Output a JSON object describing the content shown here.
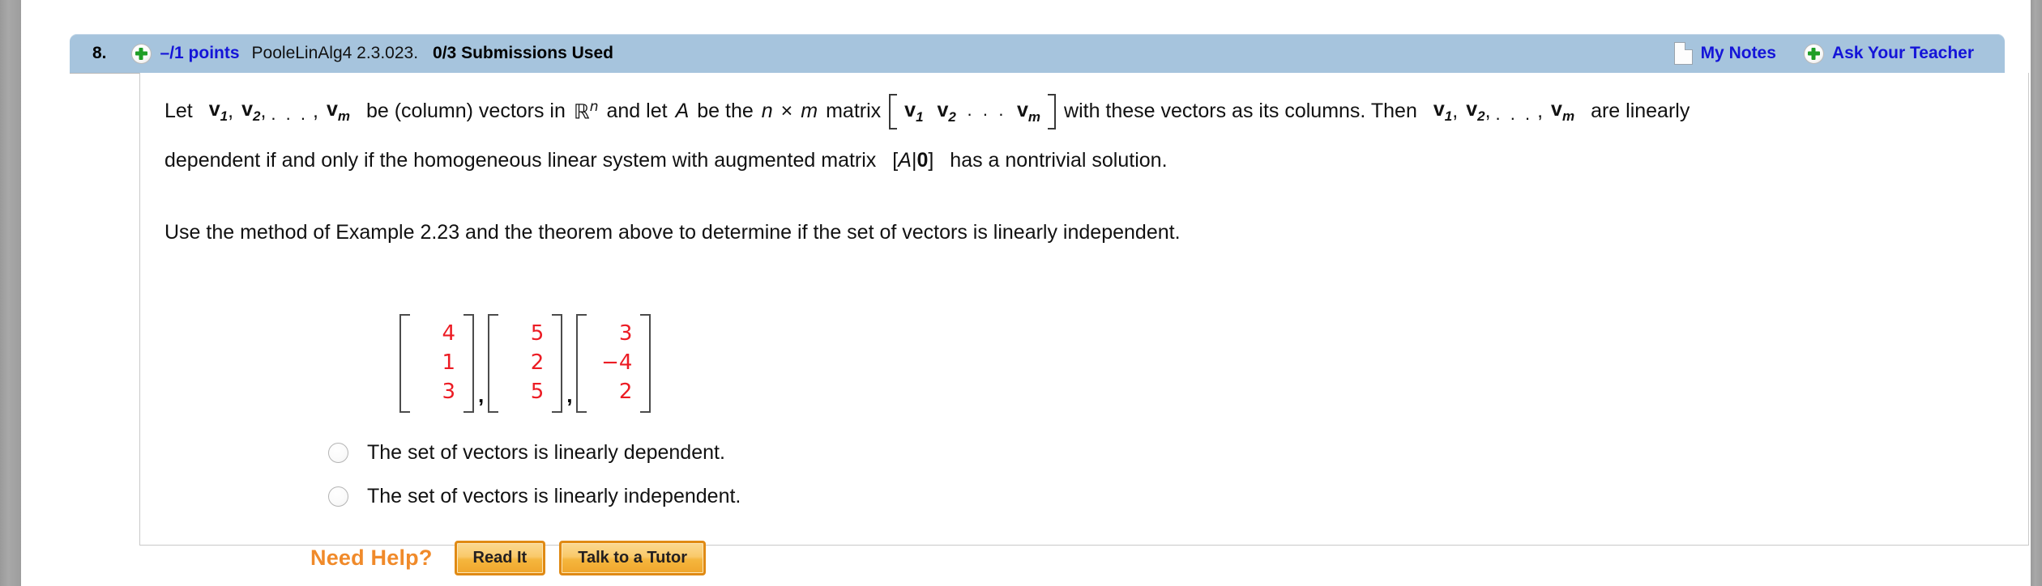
{
  "header": {
    "question_number": "8.",
    "plus_icon": "plus-circle-icon",
    "points": "–/1 points",
    "assignment_ref": "PooleLinAlg4 2.3.023.",
    "submissions": "0/3 Submissions Used",
    "my_notes_icon": "note-page-icon",
    "my_notes_label": "My Notes",
    "ask_teacher_icon": "plus-circle-icon",
    "ask_teacher_label": "Ask Your Teacher",
    "bar_color": "#a6c4dd",
    "link_color": "#1414d8"
  },
  "theorem": {
    "l1_a": "Let",
    "l1_v1": "v",
    "l1_v1_sub": "1",
    "l1_sep1": ",",
    "l1_v2": "v",
    "l1_v2_sub": "2",
    "l1_sep2": ",",
    "l1_dots": ". . .",
    "l1_sep3": ",",
    "l1_vm": "v",
    "l1_vm_sub": "m",
    "l1_b": "be (column) vectors in",
    "l1_R": "ℝ",
    "l1_R_sup": "n",
    "l1_c": "and let",
    "l1_A": "A",
    "l1_d": "be the",
    "l1_n": "n",
    "l1_times": "×",
    "l1_m": "m",
    "l1_e": "matrix",
    "l1_mat_v1": "v",
    "l1_mat_v1_sub": "1",
    "l1_mat_v2": "v",
    "l1_mat_v2_sub": "2",
    "l1_mat_dots": "· · ·",
    "l1_mat_vm": "v",
    "l1_mat_vm_sub": "m",
    "l1_f": "with these vectors as its columns. Then",
    "l1_g": "are linearly",
    "l2": "dependent if and only if the homogeneous linear system with augmented matrix",
    "l2_aug_open": "[",
    "l2_aug_A": "A",
    "l2_aug_bar": "|",
    "l2_aug_zero": "0",
    "l2_aug_close": "]",
    "l2_end": "has a nontrivial solution."
  },
  "instruction": "Use the method of Example 2.23 and the theorem above to determine if the set of vectors is linearly independent.",
  "vectors": {
    "color": "#ec1c24",
    "separator": ",",
    "items": [
      {
        "entries": [
          "4",
          "1",
          "3"
        ]
      },
      {
        "entries": [
          "5",
          "2",
          "5"
        ]
      },
      {
        "entries": [
          "3",
          "−4",
          "2"
        ]
      }
    ]
  },
  "choices": [
    {
      "label": "The set of vectors is linearly dependent.",
      "selected": false
    },
    {
      "label": "The set of vectors is linearly independent.",
      "selected": false
    }
  ],
  "need_help": {
    "title": "Need Help?",
    "title_color": "#f08a2a",
    "buttons": [
      {
        "label": "Read It"
      },
      {
        "label": "Talk to a Tutor"
      }
    ]
  }
}
